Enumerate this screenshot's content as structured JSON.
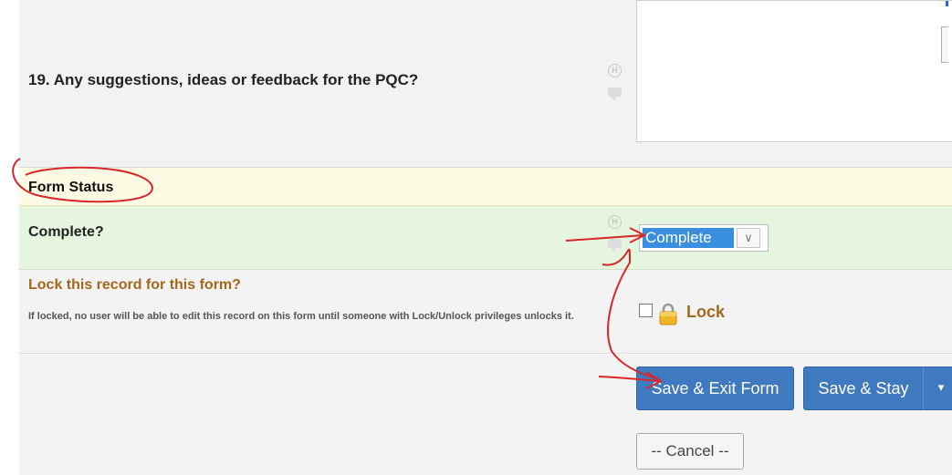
{
  "question_19": {
    "label": "19. Any suggestions, ideas or feedback for the PQC?",
    "value": ""
  },
  "form_status": {
    "header": "Form Status",
    "complete_label": "Complete?",
    "complete_value": "Complete",
    "lock_label": "Lock this record for this form?",
    "lock_note": "If locked, no user will be able to edit this record on this form until someone with Lock/Unlock privileges unlocks it.",
    "lock_checkbox_label": "Lock",
    "lock_checked": false
  },
  "buttons": {
    "save_exit": "Save & Exit Form",
    "save_stay": "Save & Stay",
    "cancel": "-- Cancel --"
  },
  "icons": {
    "field_help": "H",
    "dropdown_caret": "▾",
    "select_chevron": "∨"
  },
  "colors": {
    "primary_button": "#3f79bf",
    "lock_text": "#a3681c",
    "status_header_bg": "#fdfbe3",
    "complete_row_bg": "#e5f5e0",
    "annotation_red": "#d9262b"
  }
}
